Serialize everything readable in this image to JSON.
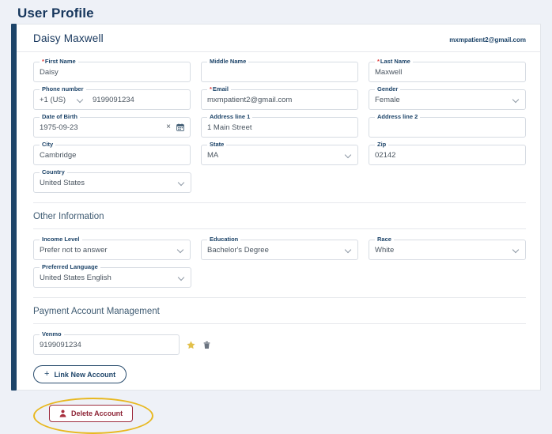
{
  "page": {
    "title": "User Profile"
  },
  "profile_header": {
    "name": "Daisy Maxwell",
    "email": "mxmpatient2@gmail.com"
  },
  "personal_info": {
    "fields": [
      {
        "label": "First Name",
        "value": "Daisy",
        "required": true
      },
      {
        "label": "Middle Name",
        "value": "",
        "required": false
      },
      {
        "label": "Last Name",
        "value": "Maxwell",
        "required": true
      },
      {
        "label": "Phone number",
        "value": "9199091234",
        "country_code": "+1 (US)",
        "required": false
      },
      {
        "label": "Email",
        "value": "mxmpatient2@gmail.com",
        "required": true
      },
      {
        "label": "Gender",
        "value": "Female",
        "required": false
      },
      {
        "label": "Date of Birth",
        "value": "1975-09-23",
        "required": false
      },
      {
        "label": "Address line 1",
        "value": "1 Main Street",
        "required": false
      },
      {
        "label": "Address line 2",
        "value": "",
        "required": false
      },
      {
        "label": "City",
        "value": "Cambridge",
        "required": false
      },
      {
        "label": "State",
        "value": "MA",
        "required": false
      },
      {
        "label": "Zip",
        "value": "02142",
        "required": false
      },
      {
        "label": "Country",
        "value": "United States",
        "required": false
      }
    ]
  },
  "other_information": {
    "title": "Other Information",
    "fields": [
      {
        "label": "Income Level",
        "value": "Prefer not to answer"
      },
      {
        "label": "Education",
        "value": "Bachelor's Degree"
      },
      {
        "label": "Race",
        "value": "White"
      },
      {
        "label": "Preferred Language",
        "value": "United States English"
      }
    ]
  },
  "payment": {
    "title": "Payment Account Management",
    "account": {
      "label": "Venmo",
      "value": "9199091234"
    },
    "star_icon": "star-icon",
    "trash_icon": "trash-icon",
    "link_button": "Link New Account",
    "plus_glyph": "+"
  },
  "danger": {
    "delete_button": "Delete Account",
    "person_icon": "person-icon"
  },
  "icons": {
    "clear": "×",
    "calendar": "calendar-icon",
    "chevron": "chevron-down-icon"
  },
  "colors": {
    "accent_navy": "#1d4469",
    "page_bg": "#eef1f7",
    "required_red": "#e03b3b",
    "danger_red": "#8e2537",
    "star_gold": "#e3c14a",
    "annotation_gold": "#e8b820"
  }
}
